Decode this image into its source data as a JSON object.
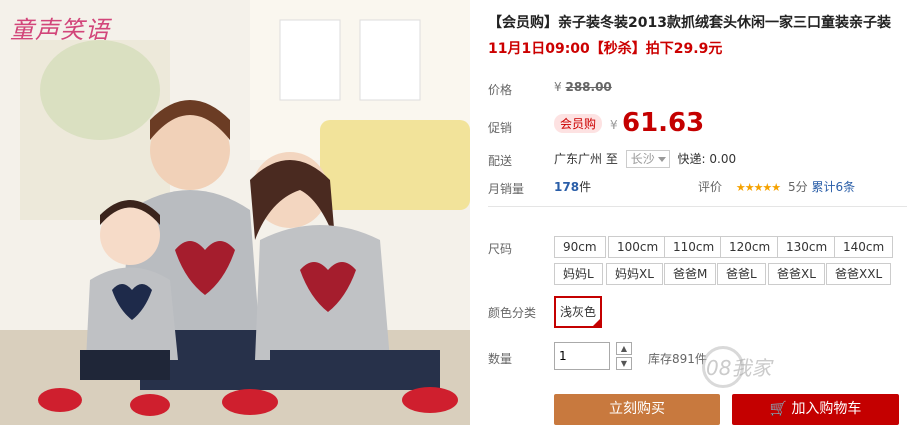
{
  "product": {
    "title": "【会员购】亲子装冬装2013款抓绒套头休闲一家三口童装亲子装",
    "promo": "11月1日09:00【秒杀】拍下29.9元",
    "image_logo": "童声笑语"
  },
  "price": {
    "label": "价格",
    "symbol": "¥",
    "original": "288.00"
  },
  "promo_price": {
    "label": "促销",
    "badge": "会员购",
    "symbol": "¥",
    "value": "61.63"
  },
  "delivery": {
    "label": "配送",
    "from": "广东广州",
    "to_word": "至",
    "city": "长沙",
    "fee": "快递: 0.00"
  },
  "sales": {
    "label": "月销量",
    "count": "178",
    "unit": "件"
  },
  "review": {
    "label": "评价",
    "stars": "★★★★★",
    "score": "5分",
    "total": "累计6条"
  },
  "size": {
    "label": "尺码",
    "options": [
      "90cm",
      "100cm",
      "110cm",
      "120cm",
      "130cm",
      "140cm",
      "妈妈L",
      "妈妈XL",
      "爸爸M",
      "爸爸L",
      "爸爸XL",
      "爸爸XXL"
    ]
  },
  "color": {
    "label": "颜色分类",
    "selected": "浅灰色"
  },
  "quantity": {
    "label": "数量",
    "value": "1",
    "stock": "库存891件"
  },
  "actions": {
    "buy_now": "立刻购买",
    "add_cart": "加入购物车"
  },
  "watermark": "08我家",
  "colors": {
    "accent": "#c40000",
    "buy": "#c8793e",
    "link": "#2a5ea8"
  }
}
